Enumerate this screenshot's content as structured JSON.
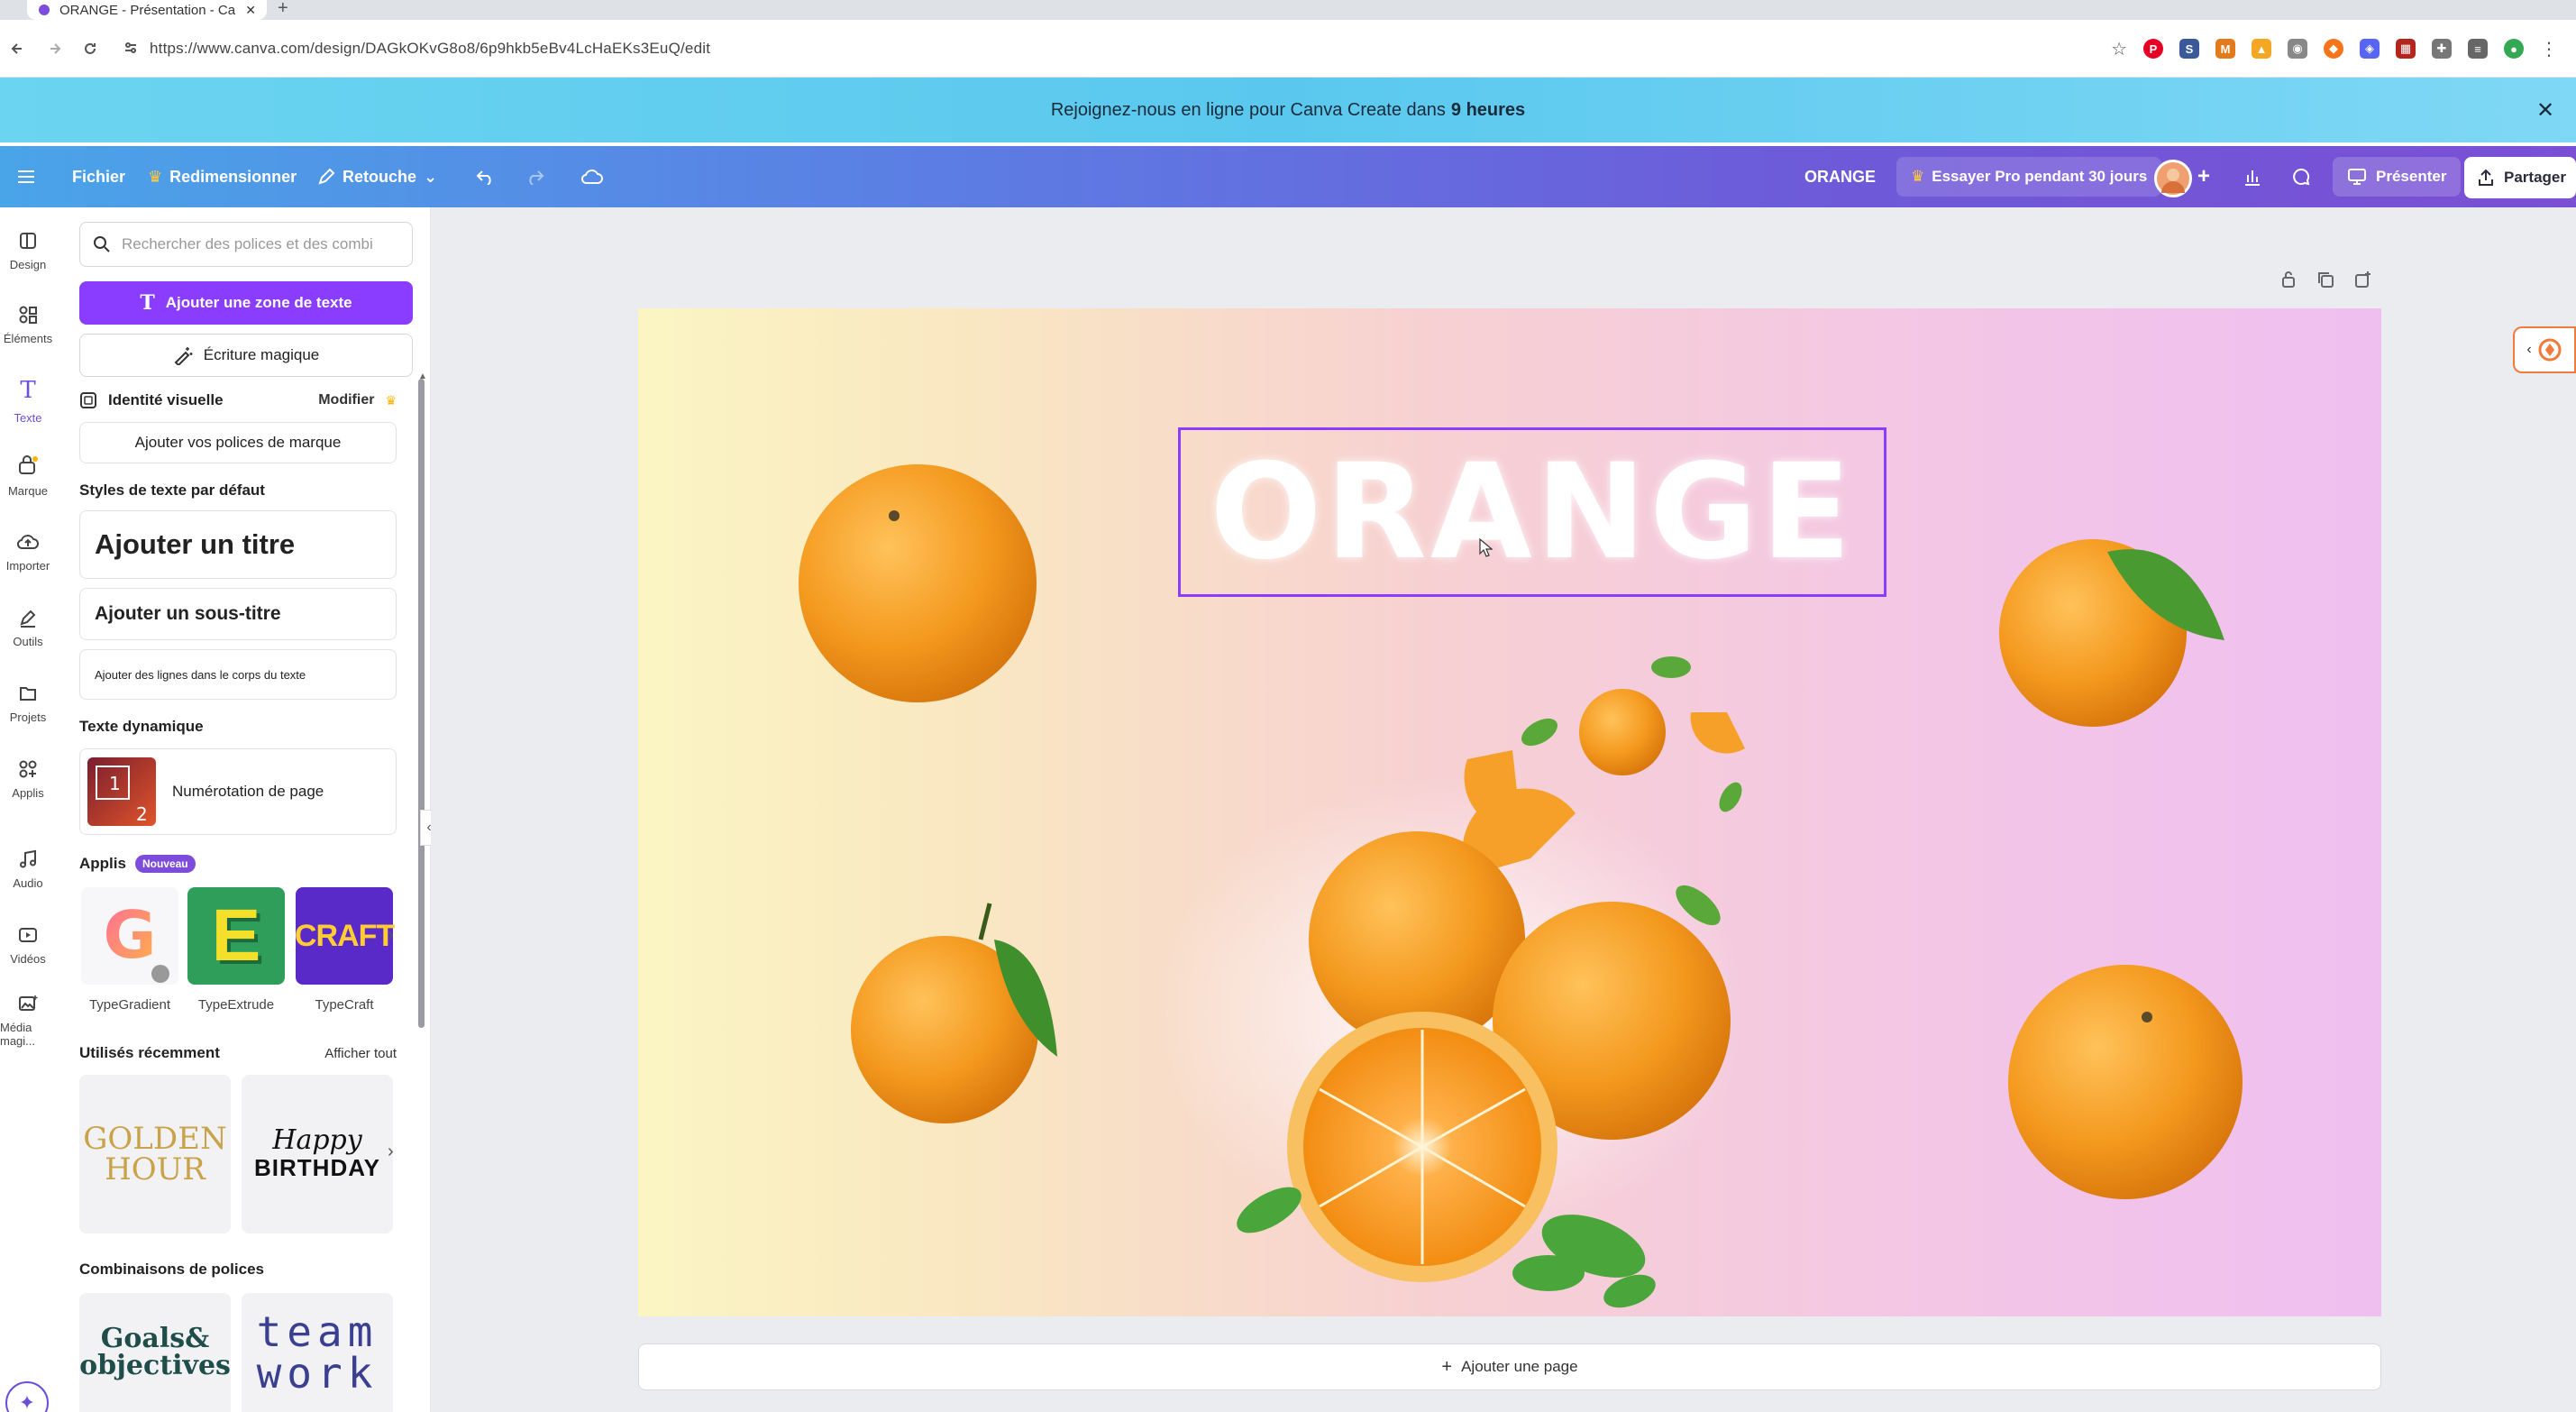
{
  "browser": {
    "tab_title": "ORANGE - Présentation - Canva",
    "url": "https://www.canva.com/design/DAGkOKvG8o8/6p9hkb5eBv4LcHaEKs3EuQ/edit"
  },
  "banner": {
    "text": "Rejoignez-nous en ligne pour Canva Create dans",
    "highlight": "9 heures"
  },
  "toolbar": {
    "file": "Fichier",
    "resize": "Redimensionner",
    "edit": "Retouche",
    "doc_title": "ORANGE",
    "try_pro": "Essayer Pro pendant 30 jours",
    "present": "Présenter",
    "share": "Partager"
  },
  "rail": [
    {
      "label": "Design",
      "icon": "layout-icon"
    },
    {
      "label": "Éléments",
      "icon": "shapes-icon"
    },
    {
      "label": "Texte",
      "icon": "text-icon"
    },
    {
      "label": "Marque",
      "icon": "brand-icon"
    },
    {
      "label": "Importer",
      "icon": "upload-icon"
    },
    {
      "label": "Outils",
      "icon": "pen-icon"
    },
    {
      "label": "Projets",
      "icon": "folder-icon"
    },
    {
      "label": "Applis",
      "icon": "apps-icon"
    },
    {
      "label": "Audio",
      "icon": "music-icon"
    },
    {
      "label": "Vidéos",
      "icon": "video-icon"
    },
    {
      "label": "Média magi...",
      "icon": "magic-media-icon"
    }
  ],
  "panel": {
    "search_placeholder": "Rechercher des polices et des combi",
    "add_text_box": "Ajouter une zone de texte",
    "magic_write": "Écriture magique",
    "brand_identity": "Identité visuelle",
    "modify": "Modifier",
    "add_brand_fonts": "Ajouter vos polices de marque",
    "default_styles": "Styles de texte par défaut",
    "add_title": "Ajouter un titre",
    "add_subtitle": "Ajouter un sous-titre",
    "add_body": "Ajouter des lignes dans le corps du texte",
    "dynamic_text": "Texte dynamique",
    "page_numbering": "Numérotation de page",
    "apps_title": "Applis",
    "new_badge": "Nouveau",
    "apps": [
      {
        "name": "TypeGradient",
        "glyph": "G"
      },
      {
        "name": "TypeExtrude",
        "glyph": "E"
      },
      {
        "name": "TypeCraft",
        "glyph": "CRAFT"
      }
    ],
    "recent_title": "Utilisés récemment",
    "see_all": "Afficher tout",
    "recent": [
      {
        "line1": "GOLDEN",
        "line2": "HOUR"
      },
      {
        "line1": "Happy",
        "line2": "BIRTHDAY"
      }
    ],
    "combos_title": "Combinaisons de polices",
    "combos": [
      {
        "line1": "Goals&",
        "line2": "objectives"
      },
      {
        "line1": "team",
        "line2": "work"
      }
    ]
  },
  "canvas": {
    "title_text": "ORANGE",
    "add_page": "Ajouter une page"
  },
  "colors": {
    "accent": "#8b3dff",
    "orange": "#f39a1e"
  }
}
